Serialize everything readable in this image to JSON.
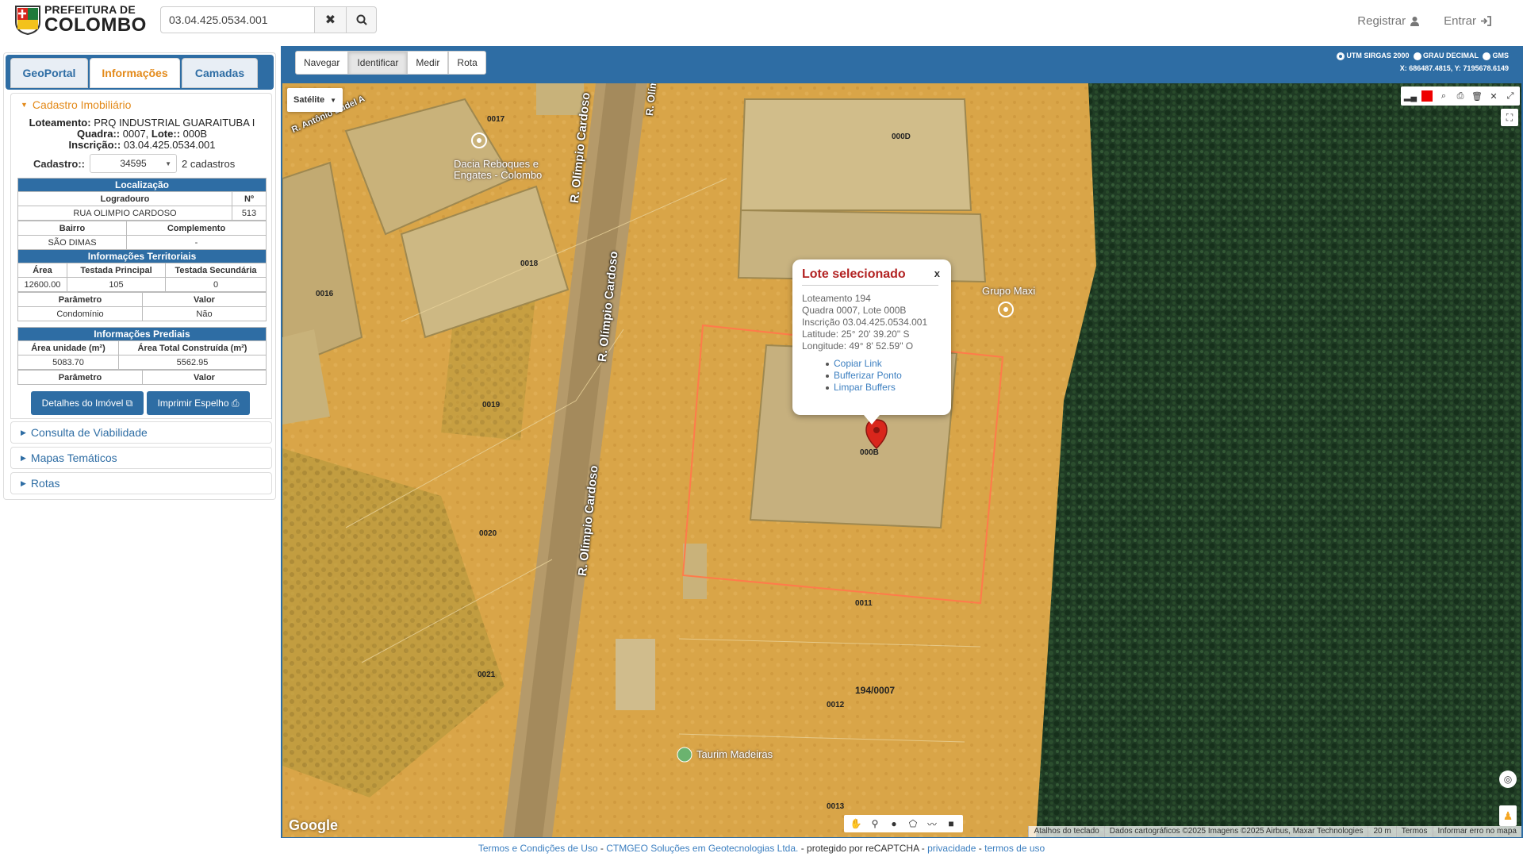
{
  "header": {
    "logo_line1": "PREFEITURA DE",
    "logo_line2": "COLOMBO",
    "search_value": "03.04.425.0534.001",
    "register_label": "Registrar",
    "login_label": "Entrar"
  },
  "tabs": [
    "GeoPortal",
    "Informações",
    "Camadas"
  ],
  "cadastro": {
    "section_title": "Cadastro Imobiliário",
    "loteamento_label": "Loteamento:",
    "loteamento_value": "PRQ INDUSTRIAL GUARAITUBA I",
    "quadra_label": "Quadra::",
    "quadra_value": "0007,",
    "lote_label": "Lote::",
    "lote_value": "000B",
    "inscricao_label": "Inscrição::",
    "inscricao_value": "03.04.425.0534.001",
    "cadastro_label": "Cadastro::",
    "cadastro_value": "34595",
    "cadastro_count": "2 cadastros"
  },
  "localizacao": {
    "title": "Localização",
    "h_logradouro": "Logradouro",
    "h_numero": "Nº",
    "logradouro": "RUA OLIMPIO CARDOSO",
    "numero": "513",
    "h_bairro": "Bairro",
    "h_complemento": "Complemento",
    "bairro": "SÃO DIMAS",
    "complemento": "-"
  },
  "territoriais": {
    "title": "Informações Territoriais",
    "h_area": "Área",
    "h_testada_principal": "Testada Principal",
    "h_testada_secundaria": "Testada Secundária",
    "area": "12600.00",
    "testada_principal": "105",
    "testada_secundaria": "0",
    "h_parametro": "Parâmetro",
    "h_valor": "Valor",
    "parametro": "Condomínio",
    "valor": "Não"
  },
  "prediais": {
    "title": "Informações Prediais",
    "h_area_unidade": "Área unidade (m²)",
    "h_area_total": "Área Total Construída (m²)",
    "area_unidade": "5083.70",
    "area_total": "5562.95",
    "h_parametro": "Parâmetro",
    "h_valor": "Valor"
  },
  "buttons": {
    "detalhes": "Detalhes do Imóvel",
    "imprimir": "Imprimir Espelho"
  },
  "collapsed_sections": [
    "Consulta de Viabilidade",
    "Mapas Temáticos",
    "Rotas"
  ],
  "map_toolbar": [
    "Navegar",
    "Identificar",
    "Medir",
    "Rota"
  ],
  "coords": {
    "opt1": "UTM SIRGAS 2000",
    "opt2": "GRAU DECIMAL",
    "opt3": "GMS",
    "xy": "X: 686487.4815, Y: 7195678.6149"
  },
  "map": {
    "map_type": "Satélite",
    "streets": [
      "R. Olímpio Cardoso",
      "R. Olímpio Cardoso",
      "R. Olímpio Cardoso",
      "R. Olímpio Ca",
      "R. Antônio Budel A"
    ],
    "pois": [
      "Dacia Reboques e",
      "Engates - Colombo",
      "Grupo Maxi",
      "Taurim Madeiras"
    ],
    "lots": [
      "0017",
      "000D",
      "0018",
      "0016",
      "0019",
      "0020",
      "0021",
      "000B",
      "0011",
      "0012",
      "0013",
      "194/0007"
    ],
    "google": "Google"
  },
  "popup": {
    "title": "Lote selecionado",
    "close": "x",
    "lines": [
      "Loteamento 194",
      "Quadra 0007, Lote 000B",
      "Inscrição 03.04.425.0534.001",
      "Latitude: 25° 20' 39.20\" S",
      "Longitude: 49° 8' 52.59\" O"
    ],
    "links": [
      "Copiar Link",
      "Bufferizar Ponto",
      "Limpar Buffers"
    ]
  },
  "attribution": [
    "Atalhos do teclado",
    "Dados cartográficos ©2025 Imagens ©2025 Airbus, Maxar Technologies",
    "20 m",
    "Termos",
    "Informar erro no mapa"
  ],
  "footer": {
    "terms": "Termos e Condições de Uso",
    "sep1": " - ",
    "company": "CTMGEO Soluções em Geotecnologias Ltda.",
    "recaptcha": " - protegido por reCAPTCHA - ",
    "privacy": "privacidade",
    "sep2": " - ",
    "tos": "termos de uso"
  },
  "colors": {
    "primary": "#2e6da4",
    "accent": "#e38a1a",
    "popup_title": "#b22222",
    "lot_outline": "#ff7b4a"
  }
}
